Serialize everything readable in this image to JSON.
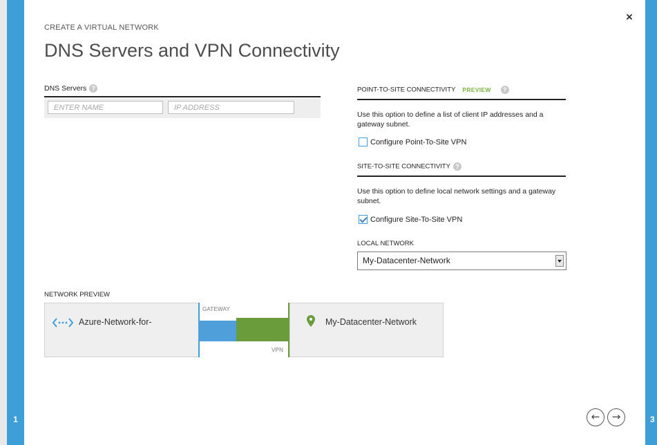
{
  "wizard": {
    "eyebrow": "CREATE A VIRTUAL NETWORK",
    "title": "DNS Servers and VPN Connectivity",
    "current_step": "1",
    "next_step": "3",
    "close_glyph": "×"
  },
  "dns": {
    "label": "DNS Servers",
    "name_placeholder": "ENTER NAME",
    "ip_placeholder": "IP ADDRESS"
  },
  "point_to_site": {
    "heading": "POINT-TO-SITE CONNECTIVITY",
    "preview_tag": "PREVIEW",
    "description": "Use this option to define a list of client IP addresses and a gateway subnet.",
    "checkbox_label": "Configure Point-To-Site VPN",
    "checked": false
  },
  "site_to_site": {
    "heading": "SITE-TO-SITE CONNECTIVITY",
    "description": "Use this option to define local network settings and a gateway subnet.",
    "checkbox_label": "Configure Site-To-Site VPN",
    "checked": true,
    "local_network_label": "LOCAL NETWORK",
    "local_network_value": "My-Datacenter-Network"
  },
  "network_preview": {
    "label": "NETWORK PREVIEW",
    "virtual_network": "Azure-Network-for-",
    "gateway_label": "GATEWAY",
    "vpn_label": "VPN",
    "local_network": "My-Datacenter-Network"
  },
  "colors": {
    "accent_blue": "#3e9fd8",
    "vpn_green": "#6a9c3c",
    "preview_green": "#7bb241"
  }
}
